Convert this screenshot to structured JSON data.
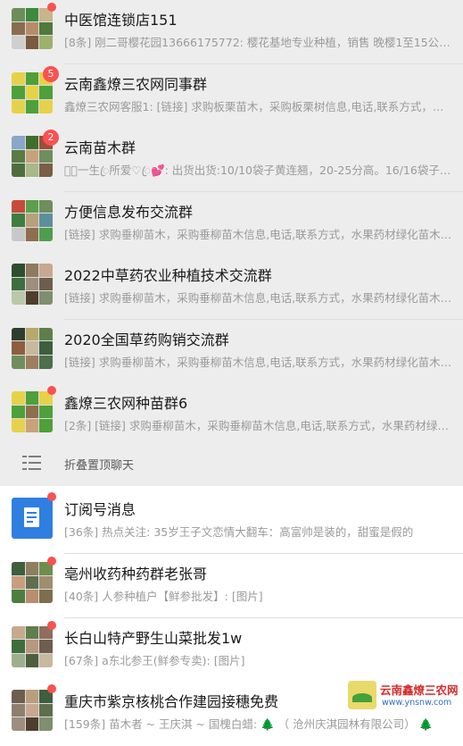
{
  "pinned_chats": [
    {
      "title": "中医馆连锁店151",
      "preview": "[8条] 刚二哥樱花园13666175772: 樱花基地专业种植，销售 晚樱1至15公分…",
      "badge": "",
      "dot": true,
      "tiles": [
        "#6c8e5a",
        "#3d8a3c",
        "#c9b58a",
        "#8a6c4e",
        "#b78c6a",
        "#4e7a3a",
        "#cfcfcf",
        "#7a5a40",
        "#9eb06e"
      ]
    },
    {
      "title": "云南鑫燎三农网同事群",
      "preview": "鑫燎三农网客服1: [链接] 求购板栗苗木，采购板栗树信息,电话,联系方式，…",
      "badge": "5",
      "dot": false,
      "tiles": [
        "#e6d24a",
        "#4ea03a",
        "#e6d24a",
        "#4ea03a",
        "#e6d24a",
        "#4ea03a",
        "#e6d24a",
        "#4ea03a",
        "#e6d24a"
      ]
    },
    {
      "title": "云南苗木群",
      "preview": "𝓜ꦿ一生ꦿ所爱♡ꦿ💕: 出货出货:10/10袋子黄连翘，20-25分高。16/16袋子…",
      "badge": "2",
      "dot": false,
      "tiles": [
        "#8aa6c8",
        "#3e6e2e",
        "#9b4e3a",
        "#5a7a46",
        "#c8a27a",
        "#6e8e5e",
        "#4e6e3e",
        "#a8b88a",
        "#7a5e46"
      ]
    },
    {
      "title": "方便信息发布交流群",
      "preview": "[链接] 求购垂柳苗木，采购垂柳苗木信息,电话,联系方式，水果药材绿化苗木…",
      "badge": "",
      "dot": false,
      "tiles": [
        "#c84a3a",
        "#5aa04a",
        "#6e8e5e",
        "#3e7e3e",
        "#b8a07a",
        "#5e8e9e",
        "#c8c8c8",
        "#8e6e4e",
        "#4e9e4e"
      ]
    },
    {
      "title": "2022中草药农业种植技术交流群",
      "preview": "[链接] 求购垂柳苗木，采购垂柳苗木信息,电话,联系方式，水果药材绿化苗木…",
      "badge": "",
      "dot": false,
      "tiles": [
        "#2e4e2e",
        "#8e7a5e",
        "#c8a890",
        "#3e6e3e",
        "#9e8e7e",
        "#6e5e4e",
        "#b8c8a8",
        "#4e3e2e",
        "#7e8e6e"
      ]
    },
    {
      "title": "2020全国草药购销交流群",
      "preview": "[链接] 求购垂柳苗木，采购垂柳苗木信息,电话,联系方式，水果药材绿化苗木…",
      "badge": "",
      "dot": false,
      "tiles": [
        "#2e3e2e",
        "#b8a86e",
        "#5e7e4e",
        "#8e5e3e",
        "#c8b89e",
        "#3e5e3e",
        "#6e8e5e",
        "#9e7e5e",
        "#4e6e4e"
      ]
    },
    {
      "title": "鑫燎三农网种苗群6",
      "preview": "[2条] [链接] 求购垂柳苗木，采购垂柳苗木信息,电话,联系方式，水果药材绿…",
      "badge": "",
      "dot": true,
      "tiles": [
        "#e6d24a",
        "#4ea03a",
        "#e6d24a",
        "#4ea03a",
        "#8e6e4e",
        "#4ea03a",
        "#e6d24a",
        "#c8a27a",
        "#4ea03a"
      ]
    }
  ],
  "fold": {
    "label": "折叠置顶聊天"
  },
  "subscription": {
    "title": "订阅号消息",
    "preview": "[36条] 热点关注: 35岁王子文恋情大翻车：高富帅是装的，甜蜜是假的",
    "dot": true
  },
  "chats": [
    {
      "title": "亳州收药种药群老张哥",
      "preview": "[40条] 人参种植户【鲜参批发】: [图片]",
      "dot": true,
      "tiles": [
        "#3e5e3e",
        "#8e7e5e",
        "#6e8e4e",
        "#c89e7e",
        "#5e6e4e",
        "#9e8e6e",
        "#4e7e3e",
        "#b88e6e",
        "#7e6e4e"
      ]
    },
    {
      "title": "长白山特产野生山菜批发1w",
      "preview": "[67条] a东北参王(鲜参专卖): [图片]",
      "dot": true,
      "tiles": [
        "#c8a88e",
        "#5e7e4e",
        "#8e6e5e",
        "#3e6e3e",
        "#b8987e",
        "#6e5e4e",
        "#9eae8e",
        "#4e5e3e",
        "#c8b89e"
      ]
    },
    {
      "title": "重庆市紫京核桃合作建园接穗免费",
      "preview": "[159条] 苗木者 ~ 王庆淇 ~ 国槐白蜡: 🌲 （ 沧州庆淇园林有限公司） 🌲",
      "dot": true,
      "tiles": [
        "#6e5e4e",
        "#b89e7e",
        "#3e5e3e",
        "#8e7e6e",
        "#c8a890",
        "#5e6e4e",
        "#9e8e7e",
        "#4e3e2e",
        "#7e8e6e"
      ]
    }
  ],
  "watermark": {
    "name": "云南鑫燎三农网",
    "url": "www.ynsnw.com"
  }
}
